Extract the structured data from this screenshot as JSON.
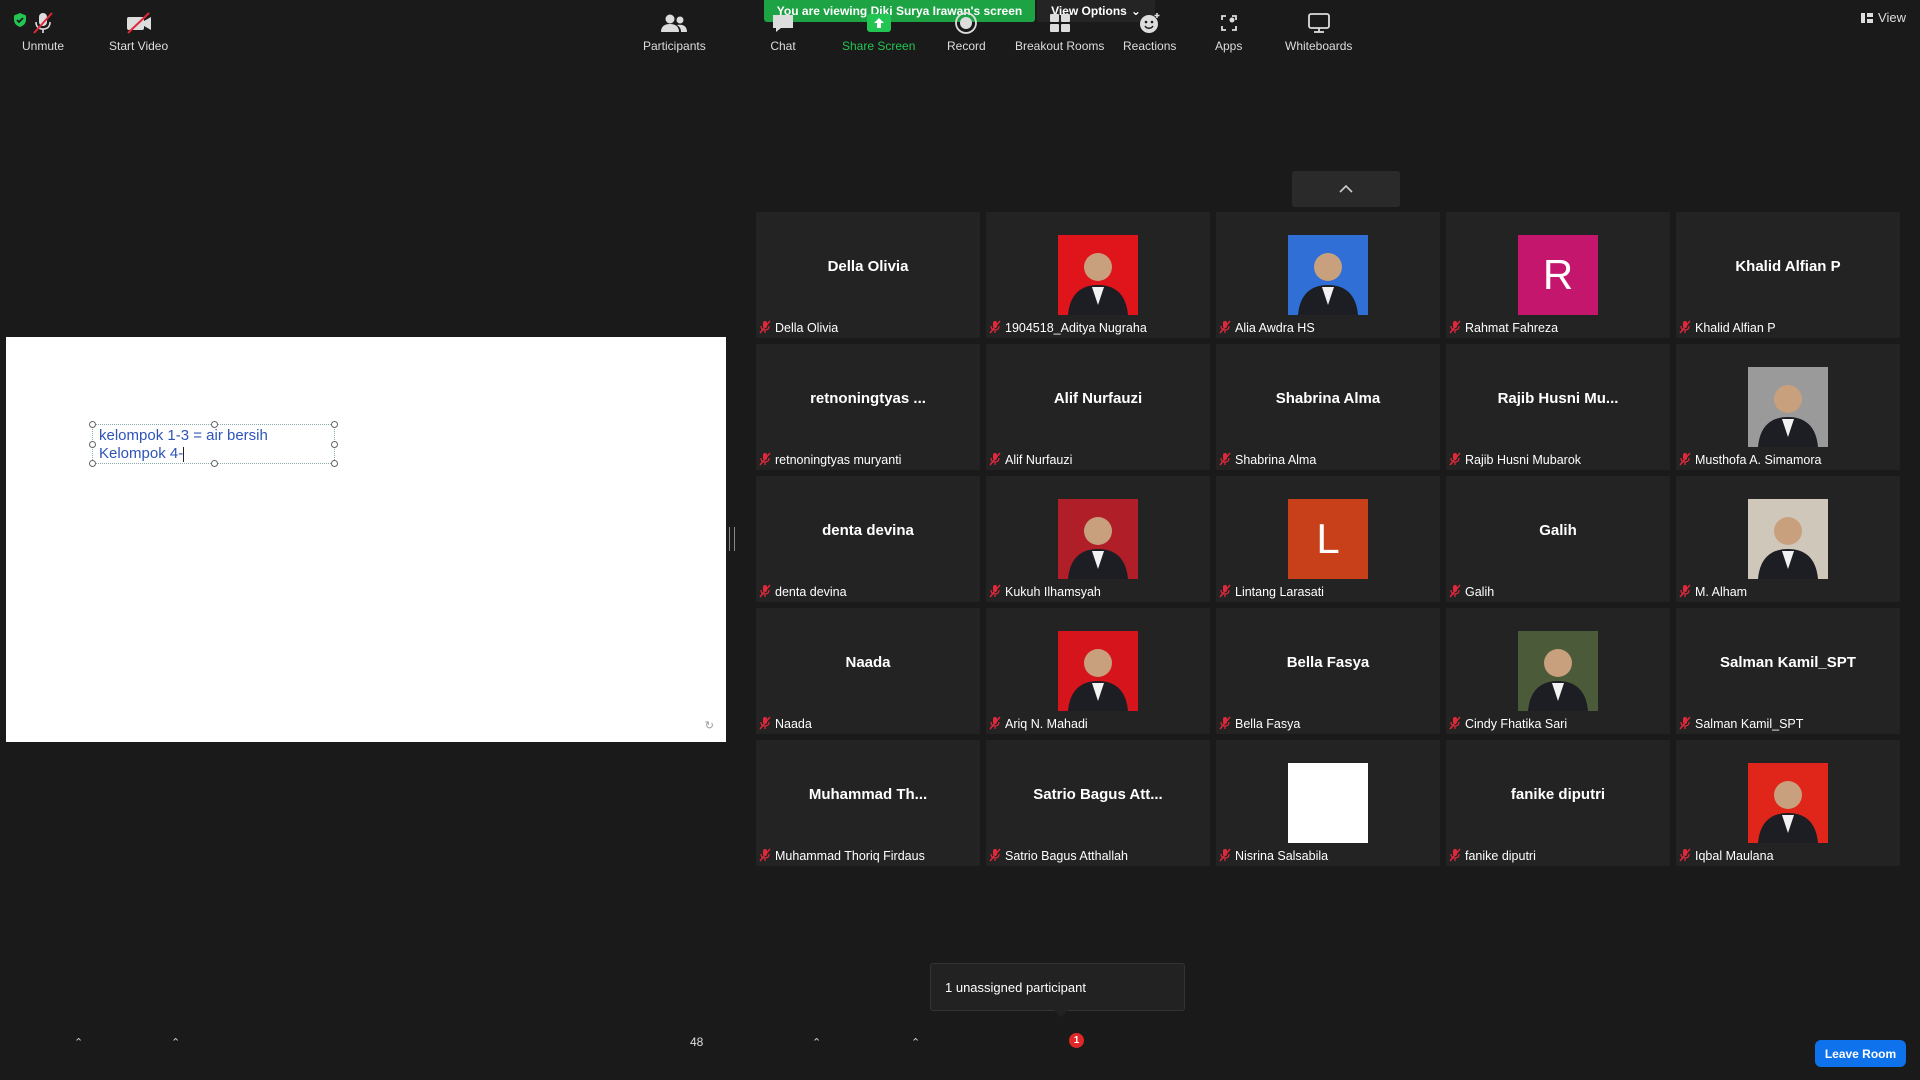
{
  "banner": {
    "viewing_text": "You are viewing Diki Surya Irawan's screen",
    "view_options_label": "View Options",
    "view_label": "View"
  },
  "shared_screen": {
    "line1": "kelompok 1-3 = air bersih",
    "line2": "Kelompok 4-"
  },
  "participants": [
    {
      "name": "Della Olivia",
      "display": "Della Olivia",
      "type": "text"
    },
    {
      "name": "1904518_Aditya Nugraha",
      "display": "",
      "type": "photo",
      "photo_bg": "#e0141b"
    },
    {
      "name": "Alia Awdra HS",
      "display": "",
      "type": "photo",
      "photo_bg": "#2f6fd6"
    },
    {
      "name": "Rahmat Fahreza",
      "display": "R",
      "type": "letter",
      "letter_bg": "#c4166c"
    },
    {
      "name": "Khalid Alfian P",
      "display": "Khalid Alfian P",
      "type": "text"
    },
    {
      "name": "retnoningtyas muryanti",
      "display": "retnoningtyas ...",
      "type": "text"
    },
    {
      "name": "Alif Nurfauzi",
      "display": "Alif Nurfauzi",
      "type": "text"
    },
    {
      "name": "Shabrina Alma",
      "display": "Shabrina Alma",
      "type": "text"
    },
    {
      "name": "Rajib Husni Mubarok",
      "display": "Rajib  Husni  Mu...",
      "type": "text"
    },
    {
      "name": "Musthofa A. Simamora",
      "display": "",
      "type": "photo",
      "photo_bg": "#9a9a9a"
    },
    {
      "name": "denta devina",
      "display": "denta devina",
      "type": "text"
    },
    {
      "name": "Kukuh Ilhamsyah",
      "display": "",
      "type": "photo",
      "photo_bg": "#b01e28"
    },
    {
      "name": "Lintang Larasati",
      "display": "L",
      "type": "letter",
      "letter_bg": "#c8401a"
    },
    {
      "name": "Galih",
      "display": "Galih",
      "type": "text"
    },
    {
      "name": "M. Alham",
      "display": "",
      "type": "photo",
      "photo_bg": "#cfc7ba"
    },
    {
      "name": "Naada",
      "display": "Naada",
      "type": "text"
    },
    {
      "name": "Ariq N. Mahadi",
      "display": "",
      "type": "photo",
      "photo_bg": "#d6141b"
    },
    {
      "name": "Bella Fasya",
      "display": "Bella Fasya",
      "type": "text"
    },
    {
      "name": "Cindy Fhatika Sari",
      "display": "",
      "type": "photo",
      "photo_bg": "#4b5a38"
    },
    {
      "name": "Salman Kamil_SPT",
      "display": "Salman Kamil_SPT",
      "type": "text"
    },
    {
      "name": "Muhammad Thoriq Firdaus",
      "display": "Muhammad  Th...",
      "type": "text"
    },
    {
      "name": "Satrio Bagus Atthallah",
      "display": "Satrio  Bagus  Att...",
      "type": "text"
    },
    {
      "name": "Nisrina Salsabila",
      "display": "",
      "type": "photo",
      "photo_bg": "#ffffff"
    },
    {
      "name": "fanike diputri",
      "display": "fanike diputri",
      "type": "text"
    },
    {
      "name": "Iqbal Maulana",
      "display": "",
      "type": "photo",
      "photo_bg": "#e0261b"
    }
  ],
  "notification": {
    "text": "1 unassigned participant"
  },
  "toolbar": {
    "unmute": "Unmute",
    "start_video": "Start Video",
    "participants": "Participants",
    "participant_count": "48",
    "chat": "Chat",
    "share_screen": "Share Screen",
    "record": "Record",
    "breakout_rooms": "Breakout Rooms",
    "breakout_badge": "1",
    "reactions": "Reactions",
    "apps": "Apps",
    "whiteboards": "Whiteboards",
    "leave_room": "Leave Room"
  },
  "colors": {
    "banner_green": "#1ea344",
    "share_green": "#23c552",
    "leave_blue": "#0e72ed",
    "muted_red": "#e0283a"
  }
}
